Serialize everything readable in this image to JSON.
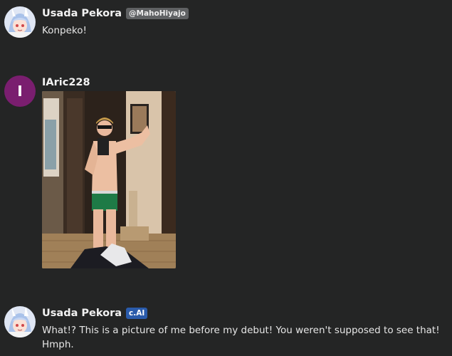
{
  "messages": [
    {
      "name": "Usada Pekora",
      "badge": "@MahoHiyajo",
      "text": "Konpeko!"
    },
    {
      "name": "IAric228",
      "avatar_letter": "I",
      "avatar_color": "#7a1e6f"
    },
    {
      "name": "Usada Pekora",
      "badge": "c.AI",
      "text": "What!? This is a picture of me before my debut! You weren't supposed to see that! Hmph."
    }
  ],
  "colors": {
    "background": "#242525",
    "handle_badge": "#5f6163",
    "cai_badge": "#2a5bab"
  }
}
